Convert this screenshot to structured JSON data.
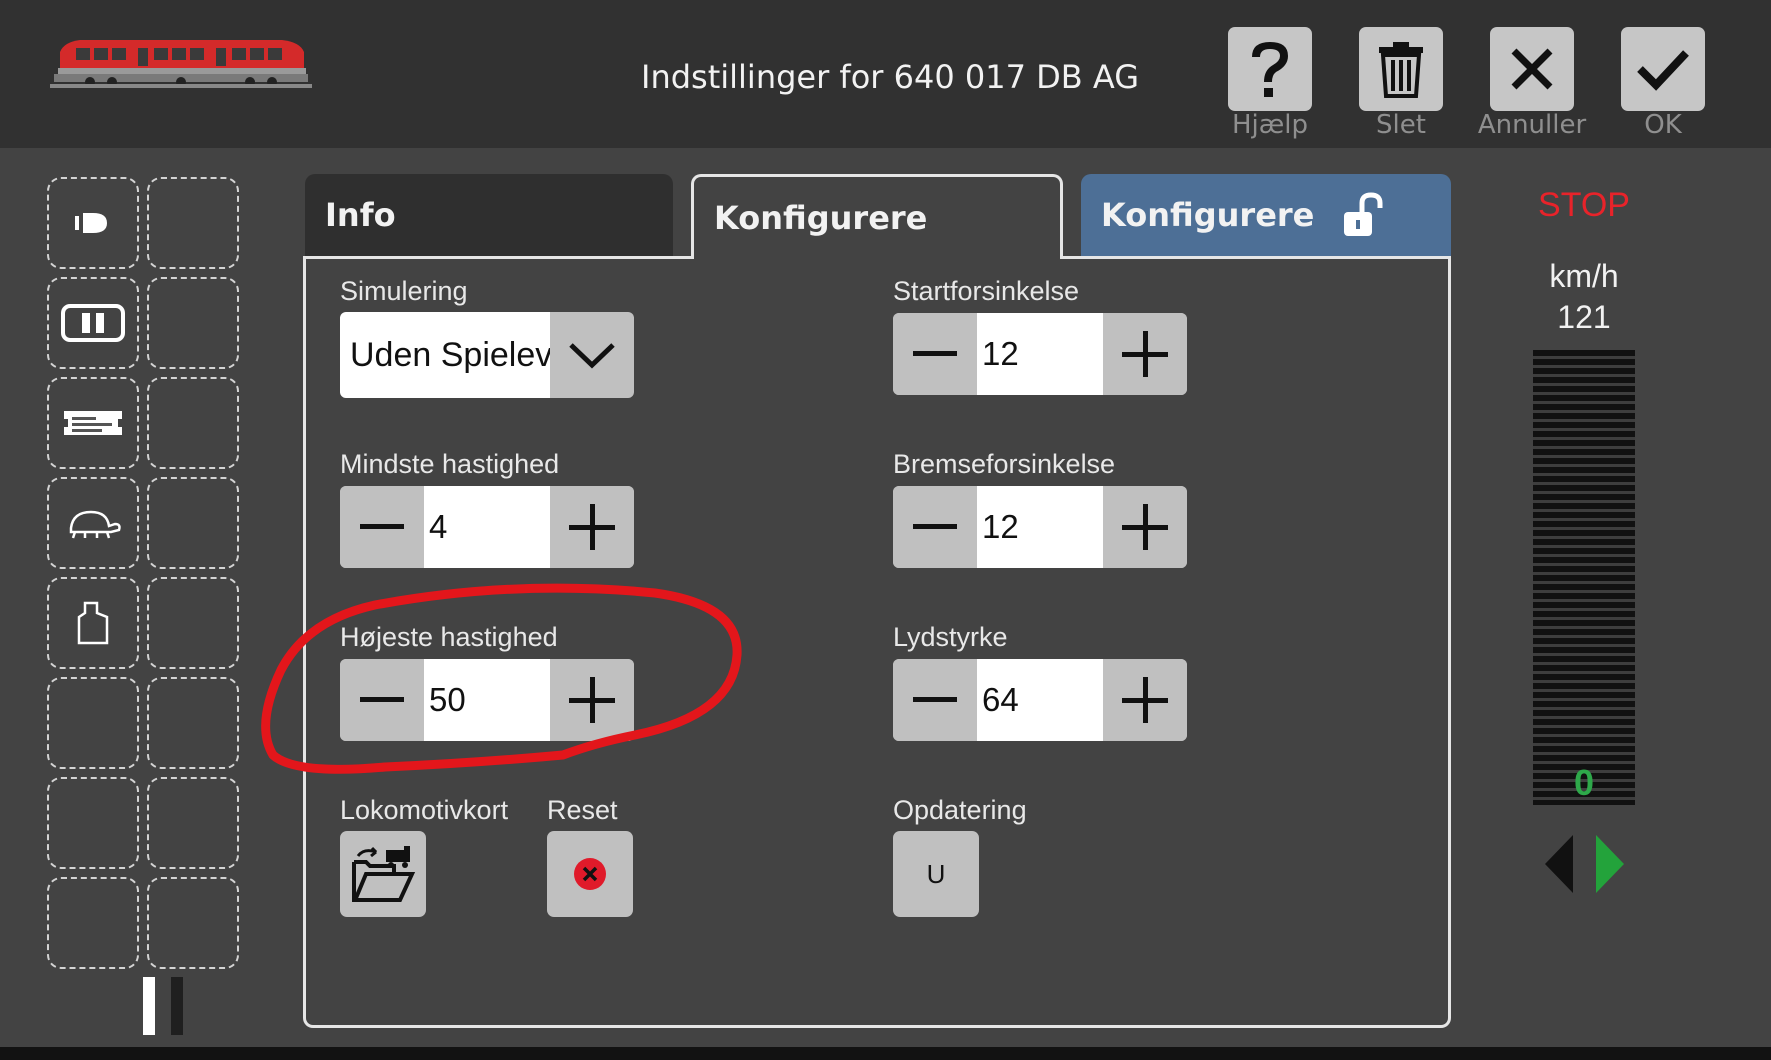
{
  "header": {
    "title": "Indstillinger for 640 017 DB AG",
    "buttons": [
      {
        "label": "Hjælp",
        "icon": "question-icon"
      },
      {
        "label": "Slet",
        "icon": "trash-icon"
      },
      {
        "label": "Annuller",
        "icon": "close-icon"
      },
      {
        "label": "OK",
        "icon": "check-icon"
      }
    ]
  },
  "sidebar": {
    "icons": [
      "headlight-icon",
      "pause-icon",
      "loco-card-icon",
      "turtle-icon",
      "weight-icon"
    ]
  },
  "tabs": [
    {
      "label": "Info",
      "state": "inactive"
    },
    {
      "label": "Konfigurere",
      "state": "active"
    },
    {
      "label": "Konfigurere",
      "state": "locked-tab",
      "icon": "unlock-icon",
      "color": "#4d6f96"
    }
  ],
  "settings": {
    "simulering": {
      "label": "Simulering",
      "value": "Uden Spielev"
    },
    "mindste": {
      "label": "Mindste hastighed",
      "value": "4"
    },
    "hojeste": {
      "label": "Højeste hastighed",
      "value": "50"
    },
    "startforsinkelse": {
      "label": "Startforsinkelse",
      "value": "12"
    },
    "bremseforsinkelse": {
      "label": "Bremseforsinkelse",
      "value": "12"
    },
    "lydstyrke": {
      "label": "Lydstyrke",
      "value": "64"
    },
    "lokomotivkort": {
      "label": "Lokomotivkort",
      "icon": "folder-loco-icon"
    },
    "reset": {
      "label": "Reset",
      "icon": "reset-x-icon"
    },
    "opdatering": {
      "label": "Opdatering",
      "button_text": "U"
    }
  },
  "speed": {
    "stop_label": "STOP",
    "unit": "km/h",
    "max": "121",
    "current": "0",
    "stop_color": "#e8232a",
    "current_color": "#2ea84a"
  },
  "annotation_color": "#e3161b"
}
